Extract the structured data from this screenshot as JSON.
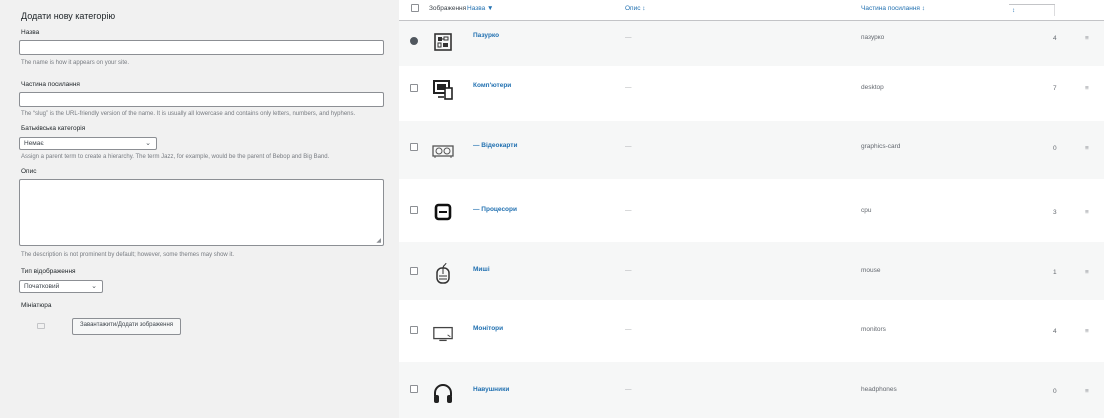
{
  "form": {
    "title": "Додати нову категорію",
    "name_label": "Назва",
    "name_value": "",
    "name_desc": "The name is how it appears on your site.",
    "slug_label": "Частина посилання",
    "slug_value": "",
    "slug_desc": "The “slug” is the URL-friendly version of the name. It is usually all lowercase and contains only letters, numbers, and hyphens.",
    "parent_label": "Батьківська категорія",
    "parent_value": "Немає",
    "parent_desc": "Assign a parent term to create a hierarchy. The term Jazz, for example, would be the parent of Bebop and Big Band.",
    "desc_label": "Опис",
    "desc_value": "",
    "desc_desc": "The description is not prominent by default; however, some themes may show it.",
    "display_label": "Тип відображення",
    "display_value": "Початковий",
    "thumb_label": "Мініатюра",
    "thumb_button": "Завантажити/Додати зображення"
  },
  "table": {
    "headers": {
      "image": "Зображення",
      "name": "Назва ▼",
      "description": "Опис ↕",
      "slug": "Частина посилання ↕",
      "count": "↕"
    },
    "rows": [
      {
        "name": "Пазурко",
        "desc": "—",
        "slug": "пазурко",
        "count": "4",
        "arrow": "≡",
        "icon": "circuit-board-icon",
        "checked": true
      },
      {
        "name": "Комп'ютери",
        "desc": "—",
        "slug": "desktop",
        "count": "7",
        "arrow": "≡",
        "icon": "desktop-computer-icon",
        "checked": false
      },
      {
        "name": "— Відеокарти",
        "desc": "—",
        "slug": "graphics-card",
        "count": "0",
        "arrow": "≡",
        "icon": "graphics-card-icon",
        "checked": false
      },
      {
        "name": "— Процесори",
        "desc": "—",
        "slug": "cpu",
        "count": "3",
        "arrow": "≡",
        "icon": "processor-icon",
        "checked": false
      },
      {
        "name": "Миші",
        "desc": "—",
        "slug": "mouse",
        "count": "1",
        "arrow": "≡",
        "icon": "mouse-icon",
        "checked": false
      },
      {
        "name": "Монітори",
        "desc": "—",
        "slug": "monitors",
        "count": "4",
        "arrow": "≡",
        "icon": "monitor-icon",
        "checked": false
      },
      {
        "name": "Навушники",
        "desc": "—",
        "slug": "headphones",
        "count": "0",
        "arrow": "≡",
        "icon": "headphones-icon",
        "checked": false
      }
    ]
  }
}
